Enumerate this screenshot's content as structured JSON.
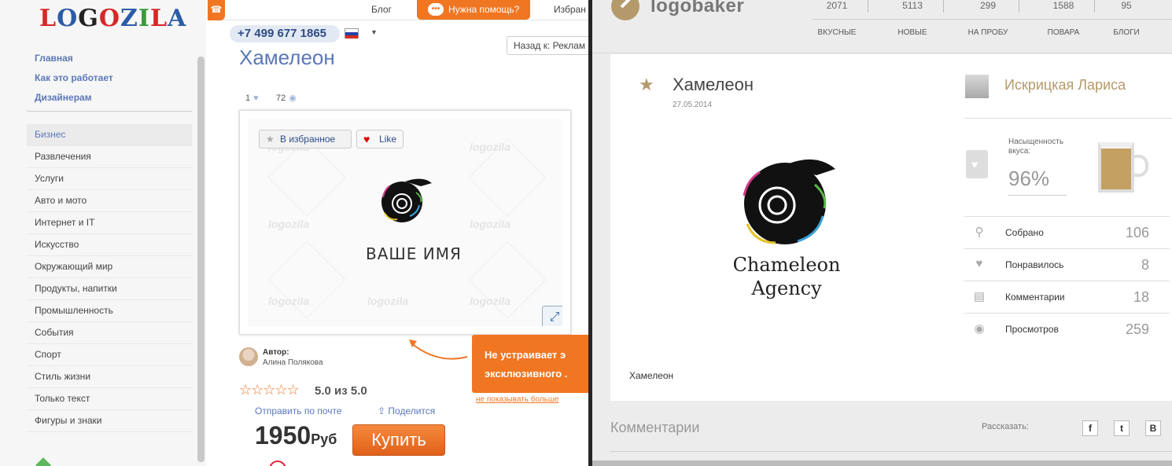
{
  "logozila": {
    "logo": "LOGOZILA",
    "nav_links": [
      "Главная",
      "Как это работает",
      "Дизайнерам"
    ],
    "categories": [
      "Бизнес",
      "Развлечения",
      "Услуги",
      "Авто и мото",
      "Интернет и IT",
      "Искусство",
      "Окружающий мир",
      "Продукты, напитки",
      "Промышленность",
      "События",
      "Спорт",
      "Стиль жизни",
      "Только текст",
      "Фигуры и знаки"
    ],
    "active_category": "Бизнес",
    "topbar": {
      "blog": "Блог",
      "help": "Нужна помощь?",
      "favorites": "Избран"
    },
    "phone": "+7 499 677 1865",
    "back_select": "Назад к: Реклам",
    "title": "Хамелеон",
    "likes": "1",
    "views": "72",
    "fav_button": "В избранное",
    "like_button": "Like",
    "watermark": "logozila",
    "placeholder_name": "ВАШЕ ИМЯ",
    "author_label": "Автор:",
    "author_name": "Алина Полякова",
    "stars": "☆☆☆☆☆",
    "rating": "5.0 из 5.0",
    "send_email": "Отправить по почте",
    "share": "Поделится",
    "price": "1950",
    "currency": "Руб",
    "buy": "Купить",
    "promo_line1": "Не устраивает э",
    "promo_line2": "эксклюзивного .",
    "dont_show": "не показывать больше"
  },
  "logobaker": {
    "logo": "logobaker",
    "stats": [
      {
        "value": "2071",
        "label": "ВКУСНЫЕ"
      },
      {
        "value": "5113",
        "label": "НОВЫЕ"
      },
      {
        "value": "299",
        "label": "НА ПРОБУ"
      },
      {
        "value": "1588",
        "label": "ПОВАРА"
      },
      {
        "value": "95",
        "label": "БЛОГИ"
      }
    ],
    "title": "Хамелеон",
    "date": "27.05.2014",
    "logo_text_line1": "Chameleon",
    "logo_text_line2": "Agency",
    "caption": "Хамелеон",
    "author": "Искрицкая Лариса",
    "saturation_label": "Насыщенность вкуса:",
    "saturation_value": "96%",
    "saturation_level": 0.96,
    "rows": [
      {
        "icon": "whisk-icon",
        "label": "Собрано",
        "value": "106"
      },
      {
        "icon": "heart-icon",
        "label": "Понравилось",
        "value": "8"
      },
      {
        "icon": "comment-icon",
        "label": "Комментарии",
        "value": "18"
      },
      {
        "icon": "eye-icon",
        "label": "Просмотров",
        "value": "259"
      }
    ],
    "comments_heading": "Комментарии",
    "share_label": "Рассказать:",
    "social": [
      "f",
      "t",
      "B"
    ]
  }
}
